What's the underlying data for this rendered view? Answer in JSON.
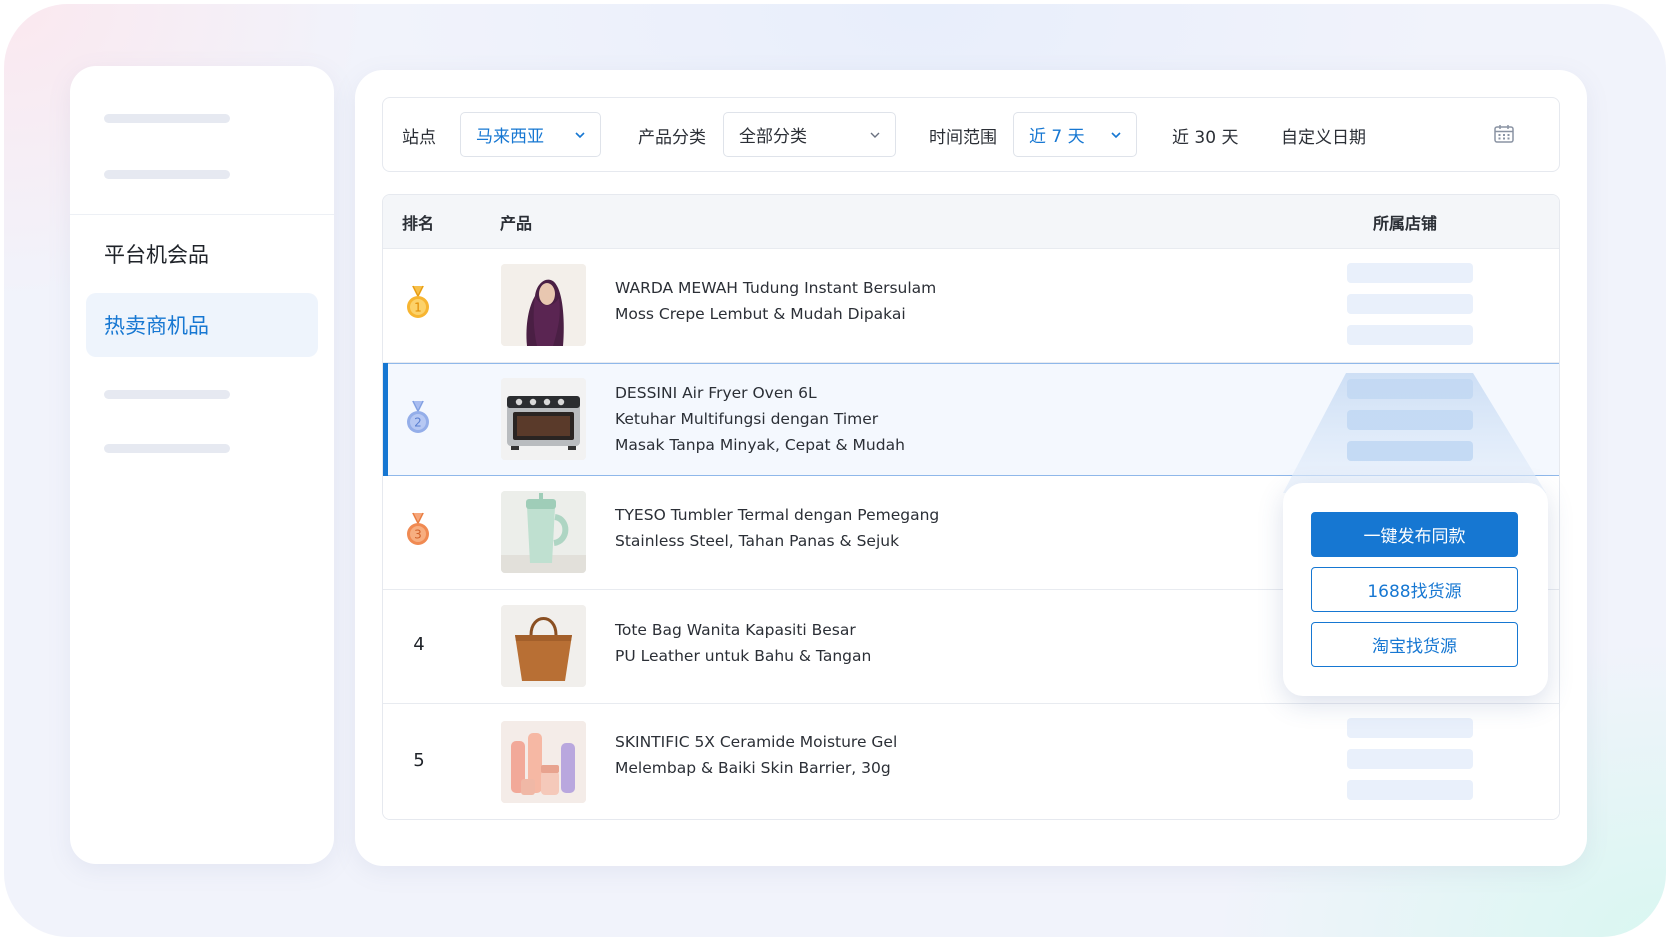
{
  "sidebar": {
    "items": [
      {
        "label": "平台机会品",
        "active": false
      },
      {
        "label": "热卖商机品",
        "active": true
      }
    ]
  },
  "filters": {
    "site_label": "站点",
    "site_value": "马来西亚",
    "category_label": "产品分类",
    "category_value": "全部分类",
    "time_label": "时间范围",
    "time_value": "近 7 天",
    "time_option_30": "近 30 天",
    "time_option_custom": "自定义日期",
    "calendar_icon": "calendar-icon"
  },
  "table": {
    "headers": {
      "rank": "排名",
      "product": "产品",
      "store": "所属店铺"
    },
    "rows": [
      {
        "rank": "1",
        "medal": "gold",
        "lines": [
          "WARDA MEWAH Tudung Instant Bersulam",
          "Moss Crepe Lembut & Mudah Dipakai"
        ]
      },
      {
        "rank": "2",
        "medal": "silver",
        "lines": [
          "DESSINI Air Fryer Oven 6L",
          "Ketuhar Multifungsi dengan Timer",
          "Masak Tanpa Minyak, Cepat & Mudah"
        ]
      },
      {
        "rank": "3",
        "medal": "bronze",
        "lines": [
          "TYESO Tumbler Termal dengan Pemegang",
          "Stainless Steel, Tahan Panas & Sejuk"
        ]
      },
      {
        "rank": "4",
        "medal": "",
        "lines": [
          "Tote Bag Wanita Kapasiti Besar",
          "PU Leather untuk Bahu & Tangan"
        ]
      },
      {
        "rank": "5",
        "medal": "",
        "lines": [
          "SKINTIFIC 5X Ceramide Moisture Gel",
          "Melembap & Baiki Skin Barrier, 30g"
        ]
      }
    ]
  },
  "popup": {
    "publish_label": "一键发布同款",
    "source_1688_label": "1688找货源",
    "source_taobao_label": "淘宝找货源"
  },
  "colors": {
    "accent": "#1677d2",
    "gold": "#f0a020",
    "silver": "#7f9fe0",
    "bronze": "#ef7f43"
  }
}
